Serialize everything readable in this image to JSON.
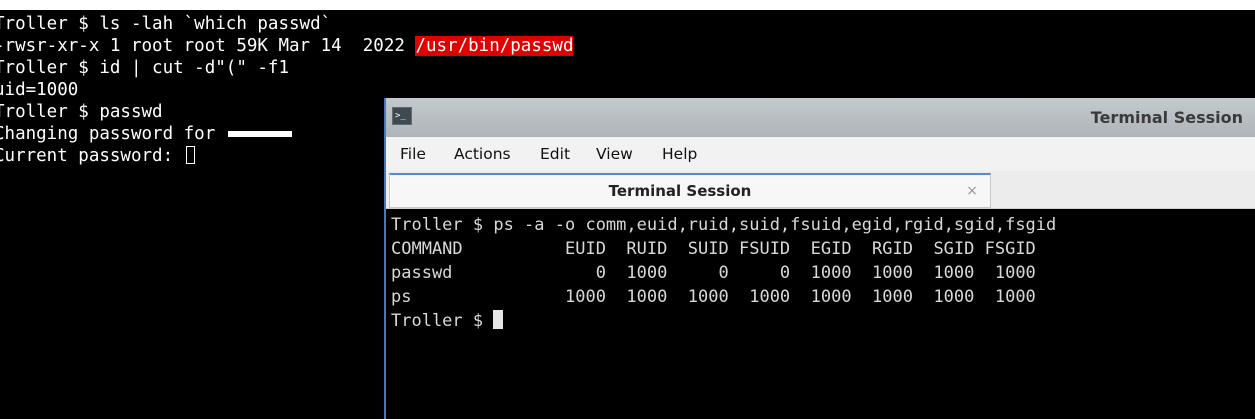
{
  "background_terminal": {
    "lines": [
      "Troller $ ls -lah `which passwd`",
      "-rwsr-xr-x 1 root root 59K Mar 14  2022 ",
      "Troller $ id | cut -d\"(\" -f1",
      "uid=1000",
      "Troller $ passwd",
      "Changing password for ",
      "Current password: "
    ],
    "highlighted_path": "/usr/bin/passwd"
  },
  "window": {
    "title": "Terminal Session",
    "icon": "terminal-icon",
    "icon_glyph": ">_",
    "menu": [
      "File",
      "Actions",
      "Edit",
      "View",
      "Help"
    ],
    "tab": {
      "label": "Terminal Session",
      "close": "×"
    }
  },
  "session": {
    "lines": [
      "Troller $ ps -a -o comm,euid,ruid,suid,fsuid,egid,rgid,sgid,fsgid",
      "COMMAND          EUID  RUID  SUID FSUID  EGID  RGID  SGID FSGID",
      "passwd              0  1000     0     0  1000  1000  1000  1000",
      "ps               1000  1000  1000  1000  1000  1000  1000  1000"
    ],
    "prompt": "Troller $ "
  },
  "colors": {
    "highlight": "#e00000",
    "terminal_bg": "#000000",
    "window_border": "#4a77b8"
  }
}
